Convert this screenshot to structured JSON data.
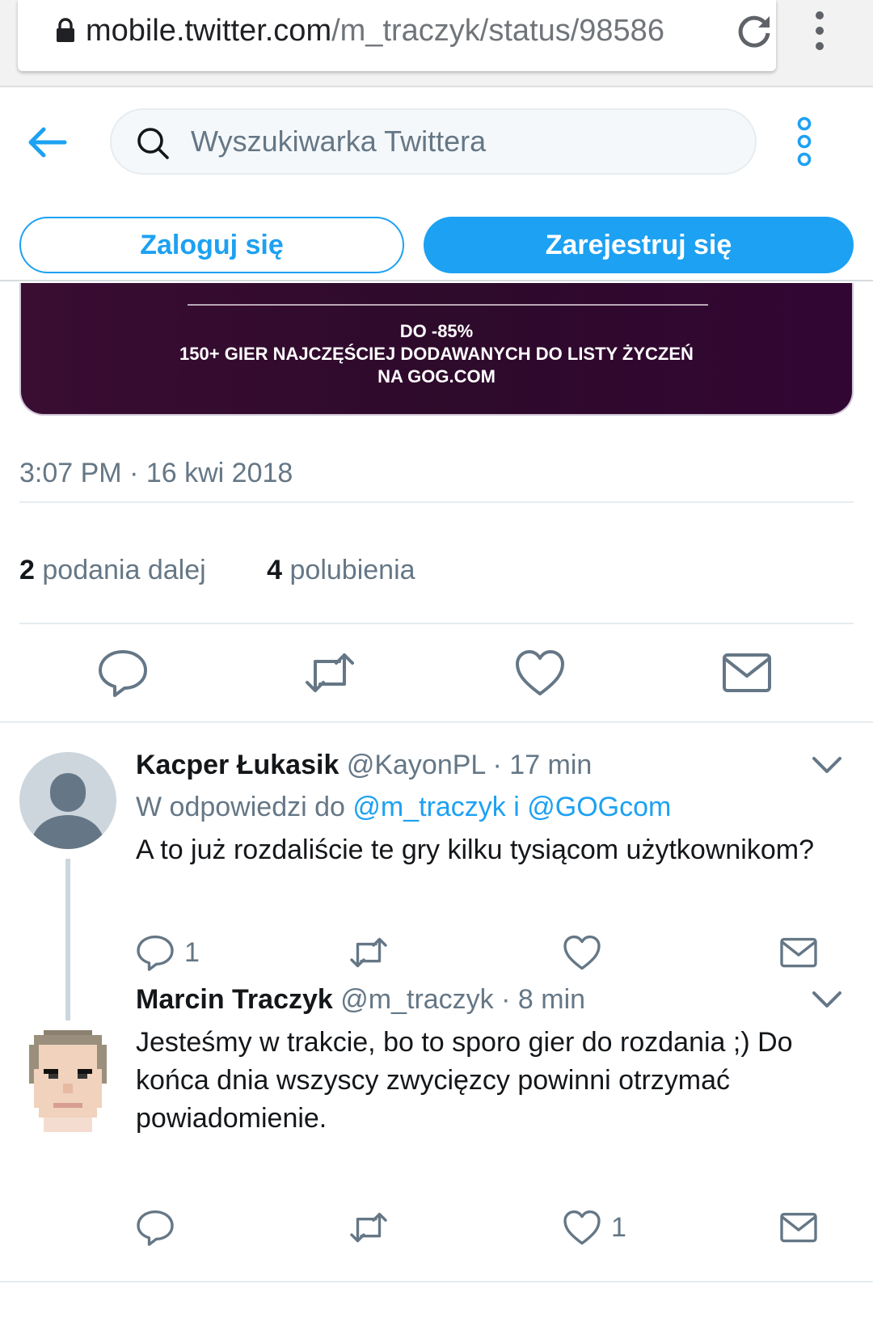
{
  "browser": {
    "url_host": "mobile.twitter.com",
    "url_path": "/m_traczyk/status/98586"
  },
  "header": {
    "search_placeholder": "Wyszukiwarka Twittera",
    "login_label": "Zaloguj się",
    "signup_label": "Zarejestruj się"
  },
  "promo": {
    "line1": "DO -85%",
    "line2": "150+ GIER NAJCZĘŚCIEJ DODAWANYCH DO LISTY ŻYCZEŃ",
    "line3": "NA GOG.COM"
  },
  "tweet": {
    "timestamp": "3:07 PM · 16 kwi 2018",
    "retweets_count": "2",
    "retweets_label": "podania dalej",
    "likes_count": "4",
    "likes_label": "polubienia"
  },
  "replies": [
    {
      "name": "Kacper Łukasik",
      "handle": "@KayonPL",
      "time": "· 17 min",
      "reply_prefix": "W odpowiedzi do",
      "reply_mentions": "@m_traczyk i @GOGcom",
      "text": "A to już rozdaliście te gry kilku tysiącom użytkownikom?",
      "reply_count": "1",
      "like_count": ""
    },
    {
      "name": "Marcin Traczyk",
      "handle": "@m_traczyk",
      "time": "· 8 min",
      "text": "Jesteśmy w trakcie, bo to sporo gier do rozdania ;) Do końca dnia wszyscy zwycięzcy powinni otrzymać powiadomienie.",
      "reply_count": "",
      "like_count": "1"
    }
  ],
  "colors": {
    "accent": "#1da1f2",
    "muted": "#657786",
    "text": "#14171a"
  },
  "icons": [
    "lock-icon",
    "reload-icon",
    "browser-menu-icon",
    "back-icon",
    "search-icon",
    "more-icon",
    "reply-icon",
    "retweet-icon",
    "like-icon",
    "message-icon",
    "chevron-down-icon"
  ]
}
